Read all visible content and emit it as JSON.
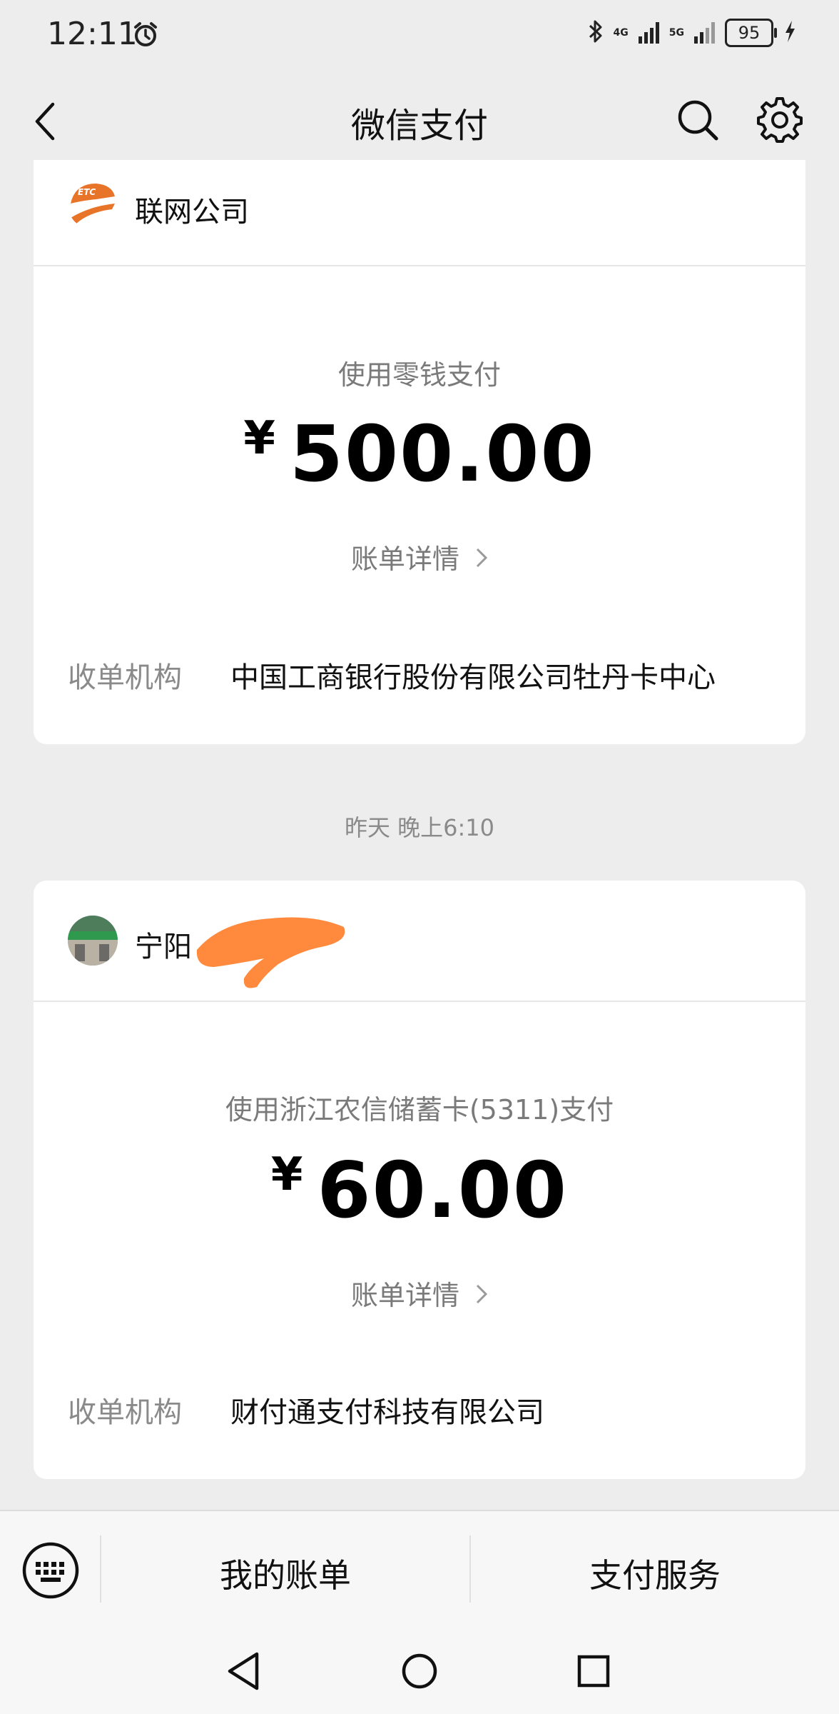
{
  "status_bar": {
    "time": "12:11",
    "net_4g": "4G",
    "net_5g": "5G",
    "battery": "95"
  },
  "header": {
    "title": "微信支付"
  },
  "transactions": [
    {
      "merchant": "联网公司",
      "pay_method": "使用零钱支付",
      "currency": "¥",
      "amount": "500.00",
      "detail_link": "账单详情",
      "institution_label": "收单机构",
      "institution": "中国工商银行股份有限公司牡丹卡中心"
    },
    {
      "timestamp": "昨天 晚上6:10",
      "merchant": "宁阳",
      "pay_method": "使用浙江农信储蓄卡(5311)支付",
      "currency": "¥",
      "amount": "60.00",
      "detail_link": "账单详情",
      "institution_label": "收单机构",
      "institution": "财付通支付科技有限公司"
    }
  ],
  "bottom_menu": {
    "items": [
      "我的账单",
      "支付服务"
    ]
  },
  "icons": {
    "alarm": "alarm-icon",
    "bluetooth": "bluetooth-icon",
    "back": "back-arrow-icon",
    "search": "search-icon",
    "settings": "gear-icon",
    "keyboard": "keyboard-icon",
    "nav_back": "triangle-back-icon",
    "nav_home": "circle-home-icon",
    "nav_recent": "square-recent-icon"
  },
  "colors": {
    "background": "#ededed",
    "card": "#ffffff",
    "secondary_text": "#7a7a7a",
    "redaction": "#ff8a3d",
    "etc_logo": "#e8742a"
  }
}
